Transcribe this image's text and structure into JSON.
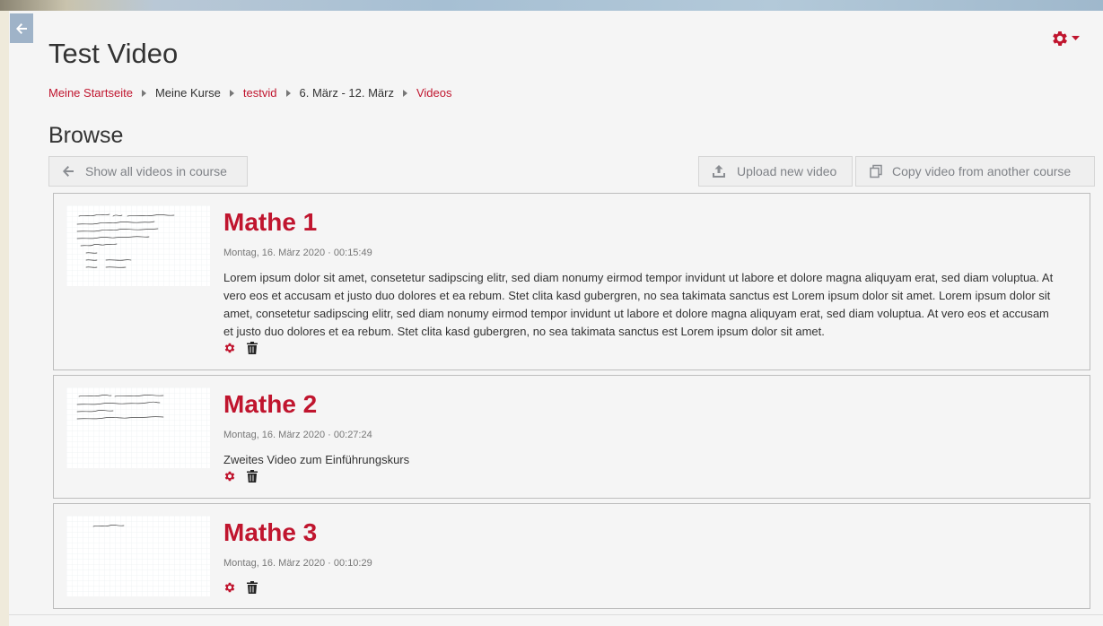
{
  "page": {
    "title": "Test Video",
    "breadcrumb": [
      {
        "label": "Meine Startseite",
        "link": true
      },
      {
        "label": "Meine Kurse",
        "link": false
      },
      {
        "label": "testvid",
        "link": true
      },
      {
        "label": "6. März - 12. März",
        "link": false
      },
      {
        "label": "Videos",
        "link": true
      }
    ]
  },
  "browse": {
    "heading": "Browse",
    "show_all_label": "Show all videos in course",
    "upload_label": "Upload new video",
    "copy_label": "Copy video from another course"
  },
  "videos": [
    {
      "title": "Mathe 1",
      "meta": "Montag, 16. März 2020 · 00:15:49",
      "description": "Lorem ipsum dolor sit amet, consetetur sadipscing elitr, sed diam nonumy eirmod tempor invidunt ut labore et dolore magna aliquyam erat, sed diam voluptua. At vero eos et accusam et justo duo dolores et ea rebum. Stet clita kasd gubergren, no sea takimata sanctus est Lorem ipsum dolor sit amet. Lorem ipsum dolor sit amet, consetetur sadipscing elitr, sed diam nonumy eirmod tempor invidunt ut labore et dolore magna aliquyam erat, sed diam voluptua. At vero eos et accusam et justo duo dolores et ea rebum. Stet clita kasd gubergren, no sea takimata sanctus est Lorem ipsum dolor sit amet."
    },
    {
      "title": "Mathe 2",
      "meta": "Montag, 16. März 2020 · 00:27:24",
      "description": "Zweites Video zum Einführungskurs"
    },
    {
      "title": "Mathe 3",
      "meta": "Montag, 16. März 2020 · 00:10:29",
      "description": ""
    }
  ],
  "icons": {
    "back": "arrow-left-icon",
    "settings": "gear-icon",
    "edit": "gear-icon",
    "delete": "trash-icon",
    "upload": "upload-icon",
    "copy": "copy-icon"
  },
  "colors": {
    "accent": "#c0152e",
    "button_text": "#7f8287",
    "back_button": "#9fb3c8"
  }
}
